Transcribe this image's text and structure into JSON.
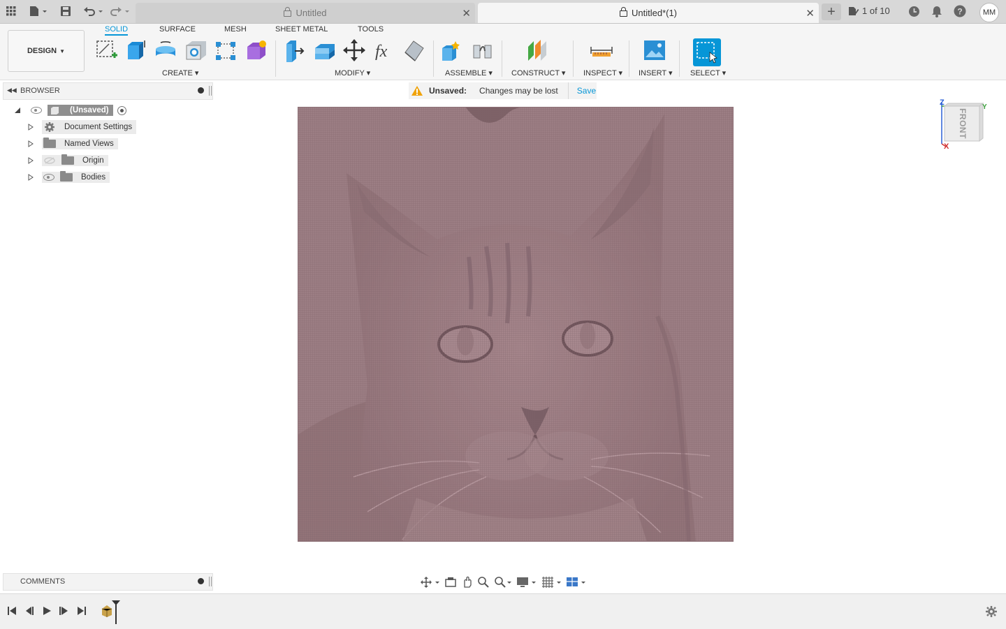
{
  "tabs": [
    {
      "label": "Untitled",
      "active": false
    },
    {
      "label": "Untitled*(1)",
      "active": true
    }
  ],
  "job_status": "1 of 10",
  "user_initials": "MM",
  "workspace": {
    "label": "DESIGN"
  },
  "ribbon_tabs": [
    "SOLID",
    "SURFACE",
    "MESH",
    "SHEET METAL",
    "TOOLS"
  ],
  "active_ribbon_tab": "SOLID",
  "tool_groups": [
    {
      "label": "CREATE"
    },
    {
      "label": "MODIFY"
    },
    {
      "label": "ASSEMBLE"
    },
    {
      "label": "CONSTRUCT"
    },
    {
      "label": "INSPECT"
    },
    {
      "label": "INSERT"
    },
    {
      "label": "SELECT"
    }
  ],
  "browser": {
    "title": "BROWSER",
    "root": "(Unsaved)",
    "items": [
      "Document Settings",
      "Named Views",
      "Origin",
      "Bodies"
    ]
  },
  "unsaved_banner": {
    "title": "Unsaved:",
    "message": "Changes may be lost",
    "action": "Save"
  },
  "viewcube": {
    "face": "FRONT",
    "axis_z": "Z",
    "axis_y": "Y",
    "axis_x": "X"
  },
  "comments": {
    "title": "COMMENTS"
  },
  "colors": {
    "accent": "#0696d7",
    "mesh": "#9a7c82",
    "warning": "#f0a30a"
  }
}
